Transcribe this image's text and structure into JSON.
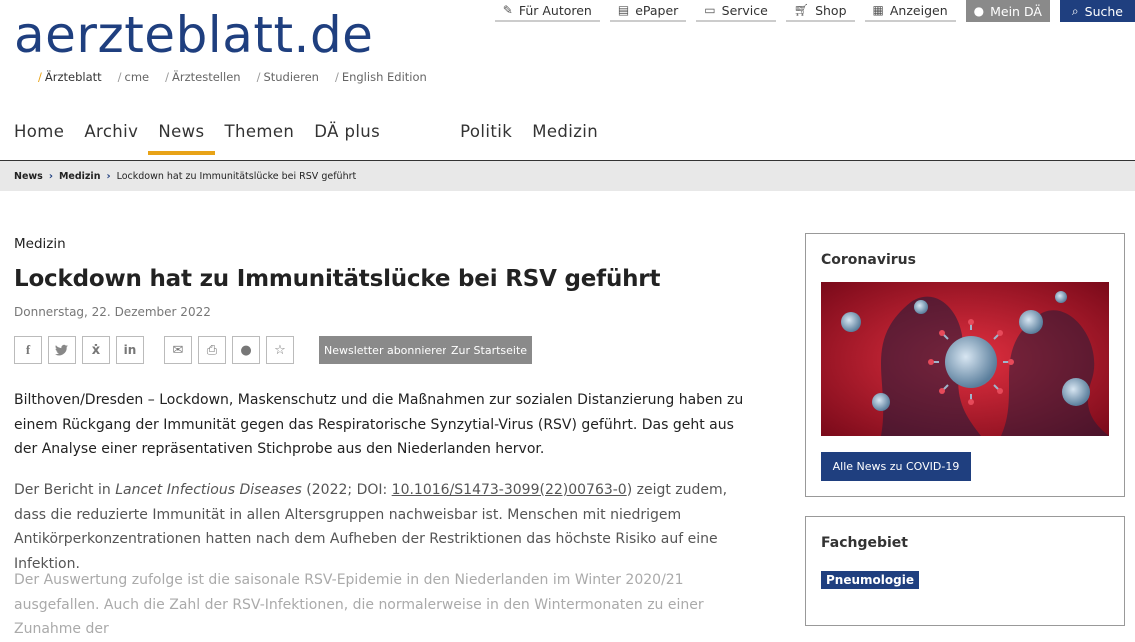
{
  "logo": "aerzteblatt.de",
  "subnav": [
    {
      "label": "Ärzteblatt",
      "active": true
    },
    {
      "label": "cme"
    },
    {
      "label": "Ärztestellen"
    },
    {
      "label": "Studieren"
    },
    {
      "label": "English Edition"
    }
  ],
  "topbar": {
    "fuer_autoren": "Für Autoren",
    "epaper": "ePaper",
    "service": "Service",
    "shop": "Shop",
    "anzeigen": "Anzeigen",
    "mein_da": "Mein DÄ",
    "suche": "Suche"
  },
  "mainnav": [
    "Home",
    "Archiv",
    "News",
    "Themen",
    "DÄ plus",
    "Politik",
    "Medizin"
  ],
  "breadcrumb": [
    "News",
    "Medizin",
    "Lockdown hat zu Immunitätslücke bei RSV geführt"
  ],
  "article": {
    "kicker": "Medizin",
    "title": "Lockdown hat zu Immunitätslücke bei RSV geführt",
    "date": "Donnerstag, 22. Dezember 2022",
    "newsletter_btn": "Newsletter abonnieren",
    "startseite_btn": "Zur Startseite",
    "p1": "Bilthoven/Dresden – Lockdown, Maskenschutz und die Maßnahmen zur sozialen Distanzierung haben zu einem Rückgang der Immunität gegen das Respiratorische Synzytial-Virus (RSV) geführt. Das geht aus der Analyse einer repräsentativen Stichprobe aus den Niederlanden hervor.",
    "p2_a": "Der Bericht in ",
    "p2_journal": "Lancet Infectious Diseases",
    "p2_b": " (2022; DOI: ",
    "p2_doi": "10.1016/S1473-3099(22)00763-0",
    "p2_c": ") zeigt zudem, dass die reduzierte Immunität in allen Altersgruppen nachweisbar ist. Menschen mit niedrigem Antikörperkonzen­trationen hatten nach dem Aufheben der Restriktionen das höchste Risiko auf eine Infektion.",
    "p3": "Der Auswertung zufolge ist die saisonale RSV-Epidemie in den Niederlanden im Winter 2020/21 ausgefallen. Auch die Zahl der RSV-Infektionen, die normalerweise in den Wintermonaten zu einer Zunahme der"
  },
  "sidebar": {
    "corona_title": "Coronavirus",
    "corona_btn": "Alle News zu COVID-19",
    "fach_title": "Fachgebiet",
    "fach_tag": "Pneumologie"
  },
  "colors": {
    "brand": "#1f3f7f",
    "accent": "#e8a317",
    "gray_btn": "#8a8a8a"
  }
}
